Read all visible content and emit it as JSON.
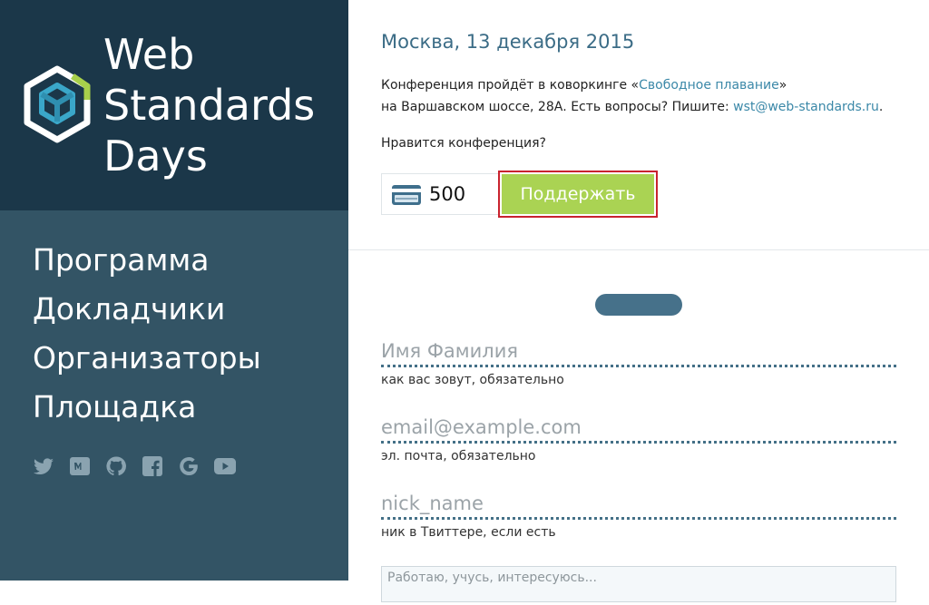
{
  "sidebar": {
    "brand": {
      "line1": "Web",
      "line2": "Standards",
      "line3": "Days"
    },
    "nav": [
      {
        "label": "Программа"
      },
      {
        "label": "Докладчики"
      },
      {
        "label": "Организаторы"
      },
      {
        "label": "Площадка"
      }
    ],
    "social": [
      "twitter-icon",
      "vk-icon",
      "github-icon",
      "facebook-icon",
      "google-icon",
      "youtube-icon"
    ],
    "colors": {
      "brand_bg": "#1b3749",
      "sidebar_bg": "#335465"
    }
  },
  "main": {
    "date": "Москва, 13 декабря 2015",
    "desc": {
      "line1_prefix": "Конференция пройдёт в коворкинге «",
      "venue_link": "Свободное плавание",
      "line1_suffix": "»",
      "line2_prefix": "на Варшавском шоссе, 28А. Есть вопросы? Пишите: ",
      "email_link": "wst@web-standards.ru",
      "line2_suffix": "."
    },
    "like_question": "Нравится конференция?",
    "donation": {
      "amount": "500",
      "button_label": "Поддержать",
      "button_color": "#aad353"
    },
    "form": {
      "name": {
        "placeholder": "Имя Фамилия",
        "hint": "как вас зовут, обязательно"
      },
      "email": {
        "placeholder": "email@example.com",
        "hint": "эл. почта, обязательно"
      },
      "nick": {
        "placeholder": "nick_name",
        "hint": "ник в Твиттере, если есть"
      },
      "about": {
        "placeholder": "Работаю, учусь, интересуюсь..."
      }
    }
  }
}
